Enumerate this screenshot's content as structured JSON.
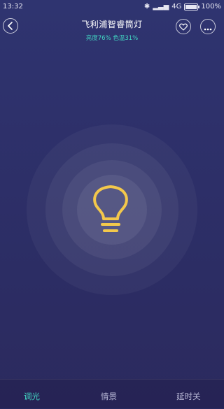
{
  "status_bar": {
    "time": "13:32",
    "network": "4G",
    "battery": "100%"
  },
  "header": {
    "title": "飞利浦智睿筒灯",
    "subtitle": "亮度76% 色温31%"
  },
  "icons": {
    "back": "back-icon",
    "favorite": "heart-icon",
    "more": "more-icon",
    "bulb": "light-bulb-icon"
  },
  "colors": {
    "accent": "#43d8c4",
    "bulb": "#f3c84b",
    "background": "#2d2f68"
  },
  "tabs": [
    {
      "label": "调光",
      "active": true
    },
    {
      "label": "情景",
      "active": false
    },
    {
      "label": "延时关",
      "active": false
    }
  ]
}
